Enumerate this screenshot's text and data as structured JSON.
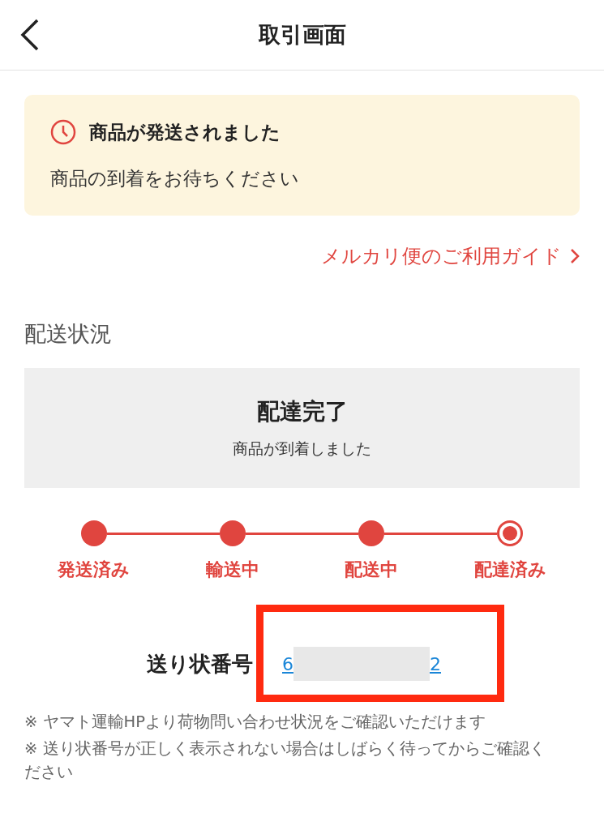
{
  "header": {
    "title": "取引画面"
  },
  "notice": {
    "title": "商品が発送されました",
    "message": "商品の到着をお待ちください"
  },
  "guide_link": {
    "label": "メルカリ便のご利用ガイド"
  },
  "delivery": {
    "heading": "配送状況",
    "status_title": "配達完了",
    "status_message": "商品が到着しました",
    "steps": [
      {
        "label": "発送済み",
        "done": true,
        "selected": false
      },
      {
        "label": "輸送中",
        "done": true,
        "selected": false
      },
      {
        "label": "配送中",
        "done": true,
        "selected": false
      },
      {
        "label": "配達済み",
        "done": true,
        "selected": true
      }
    ]
  },
  "tracking": {
    "label": "送り状番号",
    "number_start": "6",
    "number_end": "2",
    "redacted": true,
    "highlighted": true
  },
  "notes": [
    "※ ヤマト運輸HPより荷物問い合わせ状況をご確認いただけます",
    "※ 送り状番号が正しく表示されない場合はしばらく待ってからご確認ください"
  ]
}
